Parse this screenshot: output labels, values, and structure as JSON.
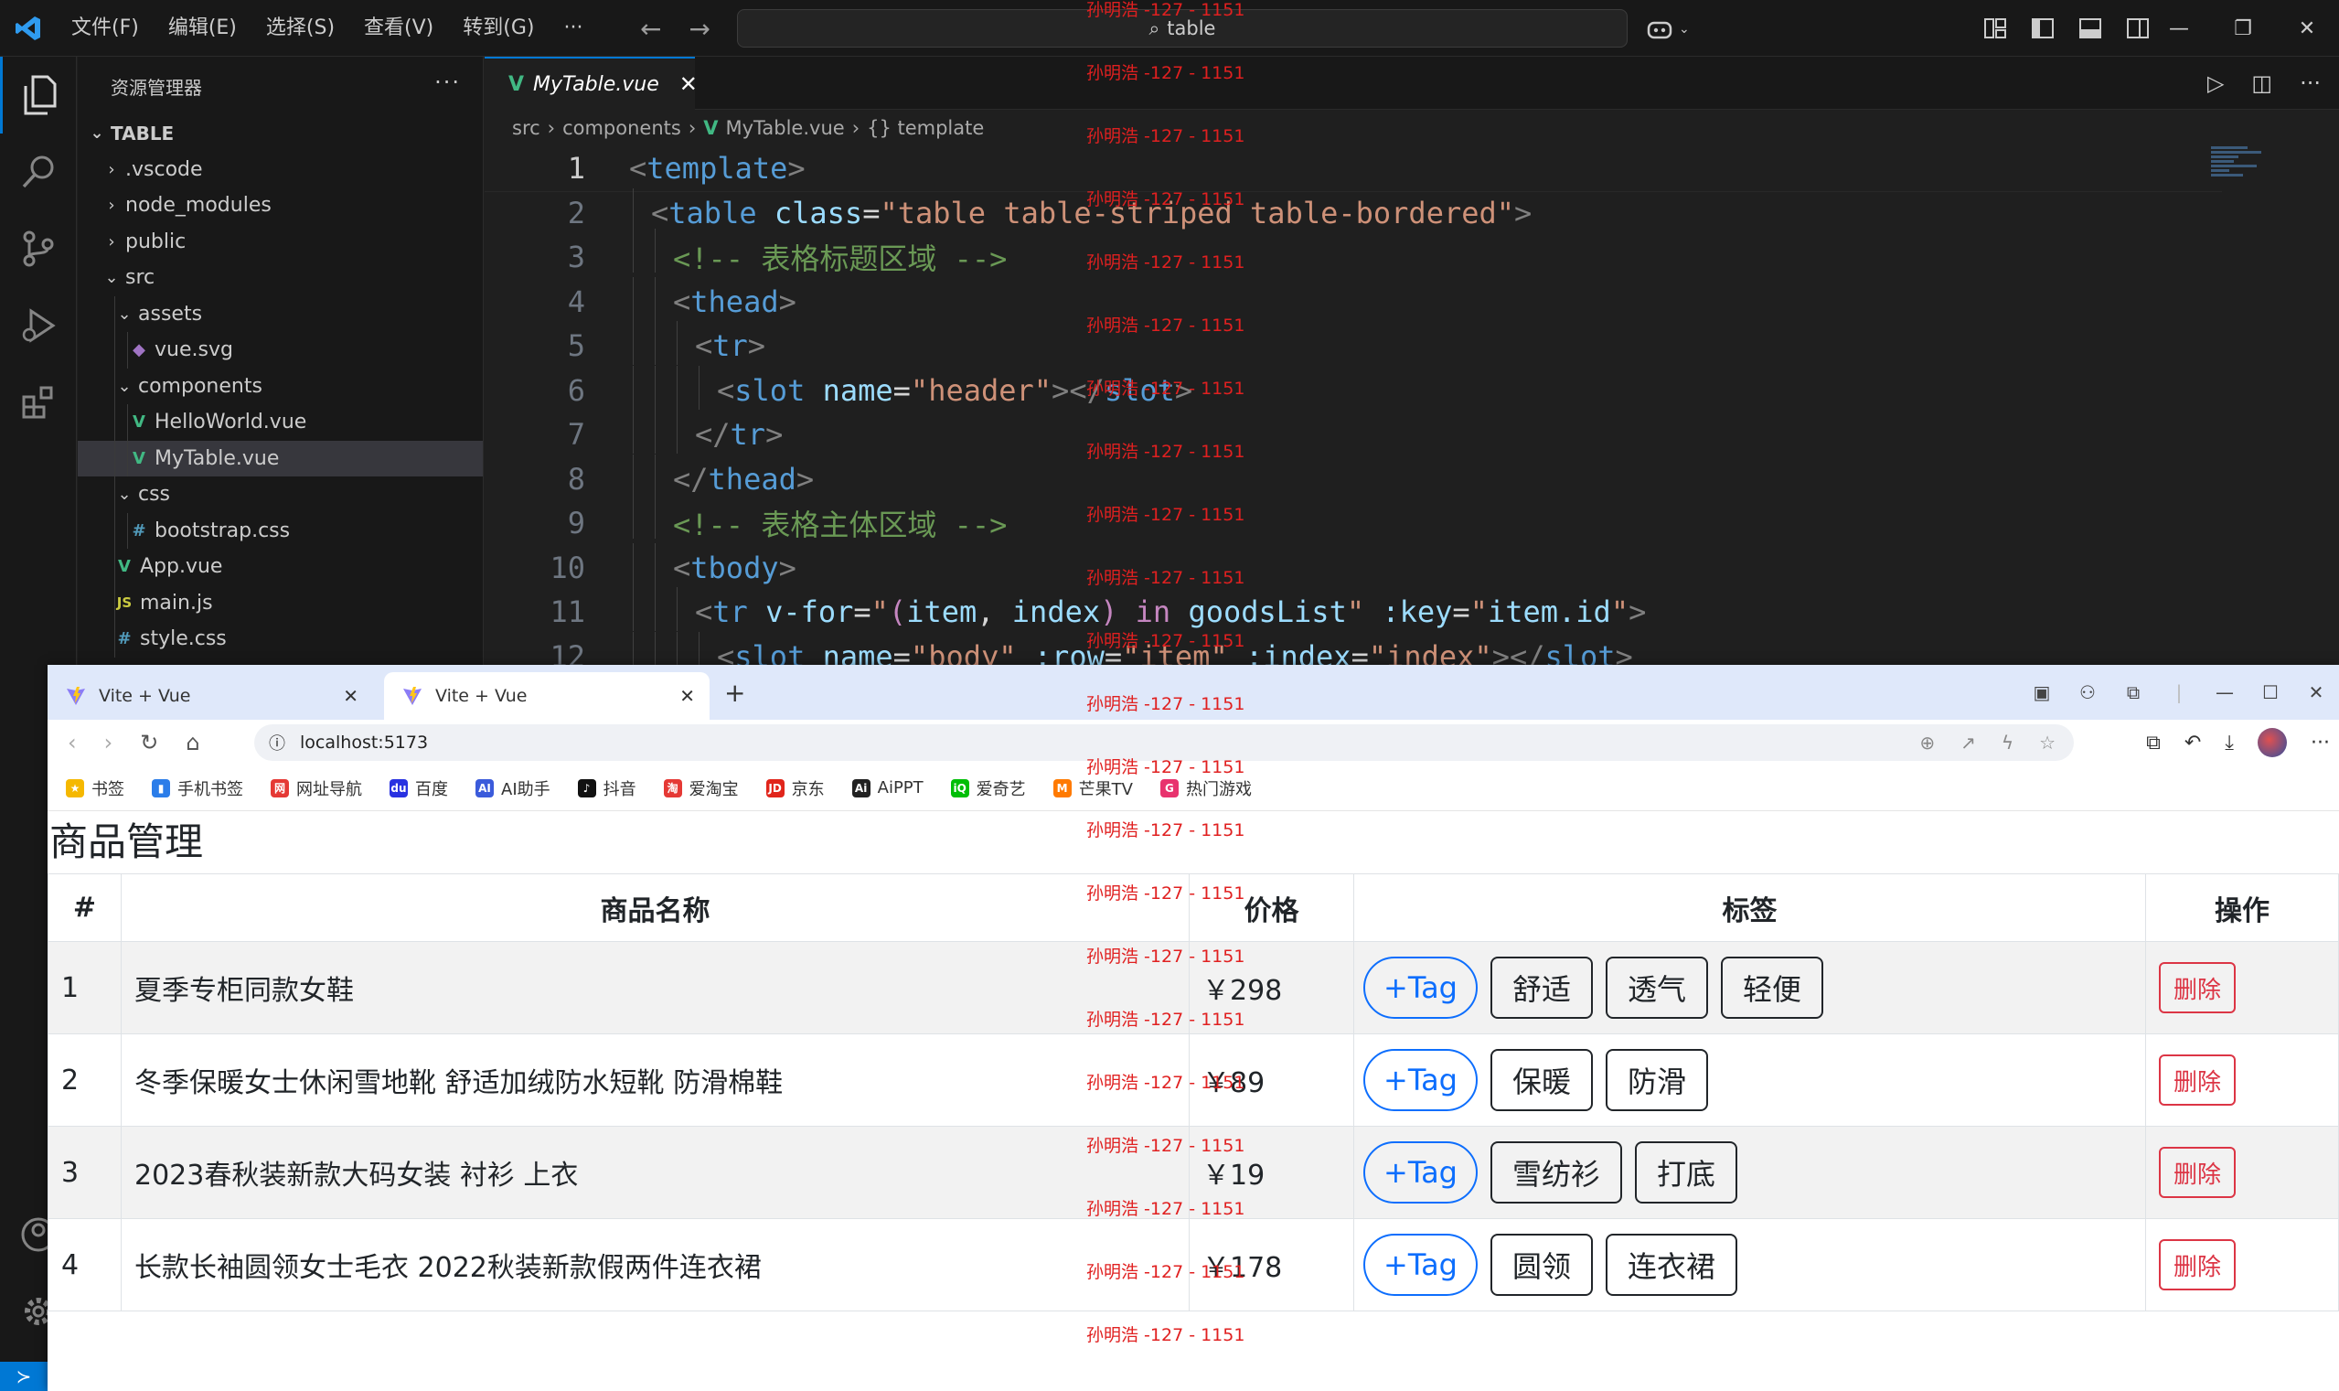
{
  "vscode": {
    "menu": [
      "文件(F)",
      "编辑(E)",
      "选择(S)",
      "查看(V)",
      "转到(G)",
      "···"
    ],
    "search_text": "table",
    "explorer_title": "资源管理器",
    "explorer_more": "···",
    "tree": [
      {
        "label": "TABLE",
        "depth": 0,
        "kind": "root",
        "chev": "open"
      },
      {
        "label": ".vscode",
        "depth": 1,
        "kind": "folder",
        "chev": "closed"
      },
      {
        "label": "node_modules",
        "depth": 1,
        "kind": "folder",
        "chev": "closed"
      },
      {
        "label": "public",
        "depth": 1,
        "kind": "folder",
        "chev": "closed"
      },
      {
        "label": "src",
        "depth": 1,
        "kind": "folder",
        "chev": "open"
      },
      {
        "label": "assets",
        "depth": 2,
        "kind": "folder",
        "chev": "open"
      },
      {
        "label": "vue.svg",
        "depth": 3,
        "kind": "svg"
      },
      {
        "label": "components",
        "depth": 2,
        "kind": "folder",
        "chev": "open"
      },
      {
        "label": "HelloWorld.vue",
        "depth": 3,
        "kind": "vue"
      },
      {
        "label": "MyTable.vue",
        "depth": 3,
        "kind": "vue",
        "selected": true
      },
      {
        "label": "css",
        "depth": 2,
        "kind": "folder",
        "chev": "open"
      },
      {
        "label": "bootstrap.css",
        "depth": 3,
        "kind": "css"
      },
      {
        "label": "App.vue",
        "depth": 2,
        "kind": "vue"
      },
      {
        "label": "main.js",
        "depth": 2,
        "kind": "js"
      },
      {
        "label": "style.css",
        "depth": 2,
        "kind": "css"
      }
    ],
    "tab": {
      "label": "MyTable.vue",
      "close": "✕"
    },
    "breadcrumb": [
      "src",
      "components",
      "MyTable.vue",
      "{} template"
    ],
    "code_lines": [
      {
        "n": "1",
        "indent": 0,
        "tokens": [
          [
            "t-punc",
            "<"
          ],
          [
            "t-tag",
            "template"
          ],
          [
            "t-punc",
            ">"
          ]
        ]
      },
      {
        "n": "2",
        "indent": 1,
        "tokens": [
          [
            "t-punc",
            "<"
          ],
          [
            "t-tag",
            "table"
          ],
          [
            "t-txt",
            " "
          ],
          [
            "t-attr",
            "class"
          ],
          [
            "t-txt",
            "="
          ],
          [
            "t-str",
            "\"table table-striped table-bordered\""
          ],
          [
            "t-punc",
            ">"
          ]
        ]
      },
      {
        "n": "3",
        "indent": 2,
        "tokens": [
          [
            "t-com",
            "<!-- 表格标题区域 -->"
          ]
        ]
      },
      {
        "n": "4",
        "indent": 2,
        "tokens": [
          [
            "t-punc",
            "<"
          ],
          [
            "t-tag",
            "thead"
          ],
          [
            "t-punc",
            ">"
          ]
        ]
      },
      {
        "n": "5",
        "indent": 3,
        "tokens": [
          [
            "t-punc",
            "<"
          ],
          [
            "t-tag",
            "tr"
          ],
          [
            "t-punc",
            ">"
          ]
        ]
      },
      {
        "n": "6",
        "indent": 4,
        "tokens": [
          [
            "t-punc",
            "<"
          ],
          [
            "t-tag",
            "slot"
          ],
          [
            "t-txt",
            " "
          ],
          [
            "t-attr",
            "name"
          ],
          [
            "t-txt",
            "="
          ],
          [
            "t-str",
            "\"header\""
          ],
          [
            "t-punc",
            "></"
          ],
          [
            "t-tag",
            "slot"
          ],
          [
            "t-punc",
            ">"
          ]
        ]
      },
      {
        "n": "7",
        "indent": 3,
        "tokens": [
          [
            "t-punc",
            "</"
          ],
          [
            "t-tag",
            "tr"
          ],
          [
            "t-punc",
            ">"
          ]
        ]
      },
      {
        "n": "8",
        "indent": 2,
        "tokens": [
          [
            "t-punc",
            "</"
          ],
          [
            "t-tag",
            "thead"
          ],
          [
            "t-punc",
            ">"
          ]
        ]
      },
      {
        "n": "9",
        "indent": 2,
        "tokens": [
          [
            "t-com",
            "<!-- 表格主体区域 -->"
          ]
        ]
      },
      {
        "n": "10",
        "indent": 2,
        "tokens": [
          [
            "t-punc",
            "<"
          ],
          [
            "t-tag",
            "tbody"
          ],
          [
            "t-punc",
            ">"
          ]
        ]
      },
      {
        "n": "11",
        "indent": 3,
        "tokens": [
          [
            "t-punc",
            "<"
          ],
          [
            "t-tag",
            "tr"
          ],
          [
            "t-txt",
            " "
          ],
          [
            "t-attr",
            "v-for"
          ],
          [
            "t-txt",
            "="
          ],
          [
            "t-str",
            "\""
          ],
          [
            "t-kw",
            "("
          ],
          [
            "t-var",
            "item"
          ],
          [
            "t-txt",
            ", "
          ],
          [
            "t-var",
            "index"
          ],
          [
            "t-kw",
            ")"
          ],
          [
            "t-txt",
            " "
          ],
          [
            "t-kw",
            "in"
          ],
          [
            "t-txt",
            " "
          ],
          [
            "t-var",
            "goodsList"
          ],
          [
            "t-str",
            "\""
          ],
          [
            "t-txt",
            " "
          ],
          [
            "t-attr",
            ":key"
          ],
          [
            "t-txt",
            "="
          ],
          [
            "t-str",
            "\""
          ],
          [
            "t-var",
            "item.id"
          ],
          [
            "t-str",
            "\""
          ],
          [
            "t-punc",
            ">"
          ]
        ]
      },
      {
        "n": "12",
        "indent": 4,
        "tokens": [
          [
            "t-punc",
            "<"
          ],
          [
            "t-tag",
            "slot"
          ],
          [
            "t-txt",
            " "
          ],
          [
            "t-attr",
            "name"
          ],
          [
            "t-txt",
            "="
          ],
          [
            "t-str",
            "\"body\""
          ],
          [
            "t-txt",
            " "
          ],
          [
            "t-attr",
            ":row"
          ],
          [
            "t-txt",
            "="
          ],
          [
            "t-str",
            "\"item\""
          ],
          [
            "t-txt",
            " "
          ],
          [
            "t-attr",
            ":index"
          ],
          [
            "t-txt",
            "="
          ],
          [
            "t-str",
            "\"index\""
          ],
          [
            "t-punc",
            "></"
          ],
          [
            "t-tag",
            "slot"
          ],
          [
            "t-punc",
            ">"
          ]
        ]
      }
    ]
  },
  "browser": {
    "tabs": [
      {
        "title": "Vite + Vue"
      },
      {
        "title": "Vite + Vue"
      }
    ],
    "url": "localhost:5173",
    "bookmarks": [
      {
        "label": "书签",
        "color": "#f5b800",
        "glyph": "★"
      },
      {
        "label": "手机书签",
        "color": "#2b7de9",
        "glyph": "▮"
      },
      {
        "label": "网址导航",
        "color": "#e53935",
        "glyph": "网"
      },
      {
        "label": "百度",
        "color": "#2932e1",
        "glyph": "du"
      },
      {
        "label": "AI助手",
        "color": "#3b5bdb",
        "glyph": "AI"
      },
      {
        "label": "抖音",
        "color": "#111111",
        "glyph": "♪"
      },
      {
        "label": "爱淘宝",
        "color": "#e53935",
        "glyph": "淘"
      },
      {
        "label": "京东",
        "color": "#e1251b",
        "glyph": "JD"
      },
      {
        "label": "AiPPT",
        "color": "#222222",
        "glyph": "Ai"
      },
      {
        "label": "爱奇艺",
        "color": "#00be06",
        "glyph": "iQ"
      },
      {
        "label": "芒果TV",
        "color": "#ff7a00",
        "glyph": "M"
      },
      {
        "label": "热门游戏",
        "color": "#e8336e",
        "glyph": "G"
      }
    ],
    "page_title": "商品管理",
    "table_headers": [
      "#",
      "商品名称",
      "价格",
      "标签",
      "操作"
    ],
    "add_tag_label": "+Tag",
    "delete_label": "删除",
    "rows": [
      {
        "idx": "1",
        "name": "夏季专柜同款女鞋",
        "price": "￥298",
        "tags": [
          "舒适",
          "透气",
          "轻便"
        ]
      },
      {
        "idx": "2",
        "name": "冬季保暖女士休闲雪地靴 舒适加绒防水短靴 防滑棉鞋",
        "price": "￥89",
        "tags": [
          "保暖",
          "防滑"
        ]
      },
      {
        "idx": "3",
        "name": "2023春秋装新款大码女装 衬衫 上衣",
        "price": "￥19",
        "tags": [
          "雪纺衫",
          "打底"
        ]
      },
      {
        "idx": "4",
        "name": "长款长袖圆领女士毛衣 2022秋装新款假两件连衣裙",
        "price": "￥178",
        "tags": [
          "圆领",
          "连衣裙"
        ]
      }
    ]
  },
  "watermark": "孙明浩 -127 - 1151"
}
